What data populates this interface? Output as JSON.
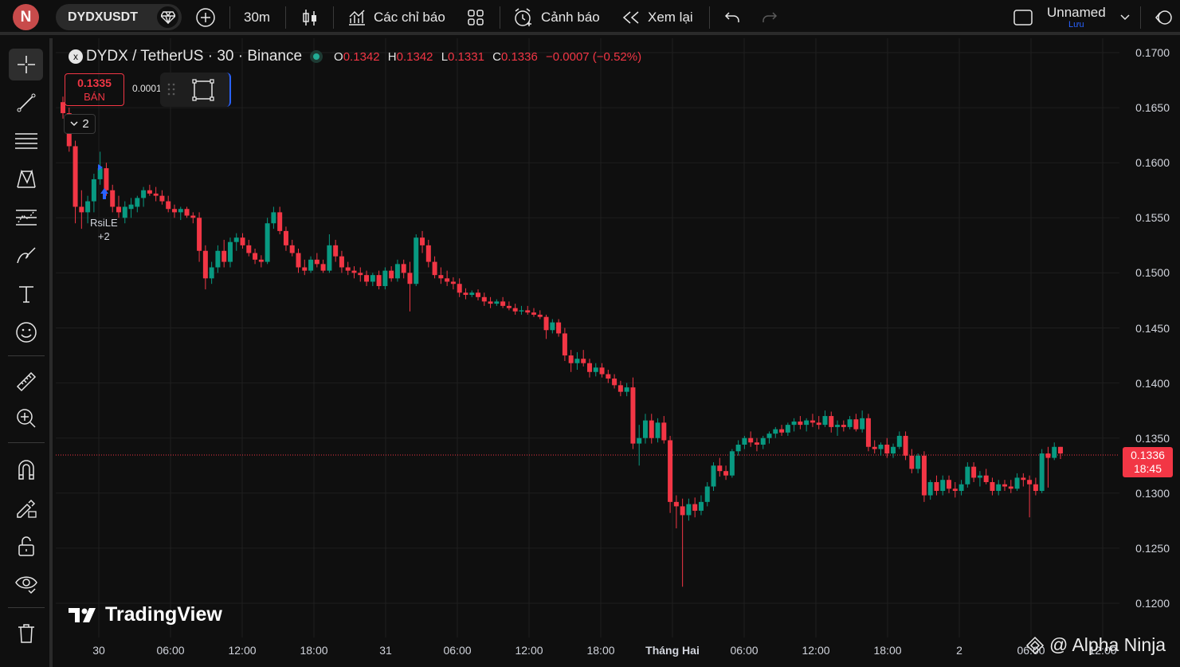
{
  "header": {
    "logo_letter": "N",
    "symbol": "DYDXUSDT",
    "interval": "30m",
    "indicators_label": "Các chỉ báo",
    "alerts_label": "Cảnh báo",
    "replay_label": "Xem lại",
    "layout_name": "Unnamed",
    "save_label": "Lưu"
  },
  "legend": {
    "title": "DYDX / TetherUS · 30 · Binance",
    "o_key": "O",
    "o_val": "0.1342",
    "h_key": "H",
    "h_val": "0.1342",
    "l_key": "L",
    "l_val": "0.1331",
    "c_key": "C",
    "c_val": "0.1336",
    "change": "−0.0007 (−0.52%)"
  },
  "trade": {
    "sell_price": "0.1335",
    "sell_label": "BÁN",
    "spread": "0.0001"
  },
  "indicators_collapse": "2",
  "signal": {
    "label": "RsiLE",
    "extra": "+2"
  },
  "price_axis": [
    "0.1700",
    "0.1650",
    "0.1600",
    "0.1550",
    "0.1500",
    "0.1450",
    "0.1400",
    "0.1350",
    "0.1300",
    "0.1250",
    "0.1200"
  ],
  "last_price": {
    "value": "0.1336",
    "countdown": "18:45"
  },
  "time_axis": [
    "30",
    "06:00",
    "12:00",
    "18:00",
    "31",
    "06:00",
    "12:00",
    "18:00",
    "Tháng Hai",
    "06:00",
    "12:00",
    "18:00",
    "2",
    "06:00",
    "12:00"
  ],
  "brand": "TradingView",
  "watermark": "@ Alpha Ninja",
  "colors": {
    "up": "#089981",
    "down": "#f23645",
    "background": "#0f0f0f",
    "grid": "#1f1f1f"
  },
  "chart_data": {
    "type": "candlestick",
    "ylim": [
      0.1195,
      0.1705
    ],
    "last_price": 0.1336,
    "candles": [
      [
        0.1655,
        0.166,
        0.164,
        0.1645
      ],
      [
        0.1645,
        0.165,
        0.161,
        0.1615
      ],
      [
        0.1615,
        0.162,
        0.1545,
        0.156
      ],
      [
        0.156,
        0.1575,
        0.154,
        0.1555
      ],
      [
        0.1555,
        0.157,
        0.1545,
        0.1565
      ],
      [
        0.1565,
        0.159,
        0.1555,
        0.1585
      ],
      [
        0.1585,
        0.161,
        0.158,
        0.1595
      ],
      [
        0.1595,
        0.16,
        0.157,
        0.1575
      ],
      [
        0.1575,
        0.158,
        0.1555,
        0.156
      ],
      [
        0.156,
        0.157,
        0.155,
        0.1555
      ],
      [
        0.155,
        0.1565,
        0.1545,
        0.156
      ],
      [
        0.1558,
        0.1568,
        0.155,
        0.1562
      ],
      [
        0.156,
        0.157,
        0.1555,
        0.1568
      ],
      [
        0.1568,
        0.1578,
        0.156,
        0.1575
      ],
      [
        0.1575,
        0.158,
        0.157,
        0.1572
      ],
      [
        0.1572,
        0.1578,
        0.1565,
        0.157
      ],
      [
        0.157,
        0.1575,
        0.1562,
        0.1565
      ],
      [
        0.1565,
        0.157,
        0.1555,
        0.1558
      ],
      [
        0.1558,
        0.1562,
        0.155,
        0.1555
      ],
      [
        0.1555,
        0.156,
        0.1548,
        0.1558
      ],
      [
        0.1558,
        0.156,
        0.155,
        0.1552
      ],
      [
        0.1552,
        0.1555,
        0.1545,
        0.155
      ],
      [
        0.155,
        0.1555,
        0.151,
        0.152
      ],
      [
        0.152,
        0.1525,
        0.1485,
        0.1495
      ],
      [
        0.1495,
        0.151,
        0.149,
        0.1505
      ],
      [
        0.1505,
        0.1525,
        0.15,
        0.152
      ],
      [
        0.152,
        0.153,
        0.1505,
        0.151
      ],
      [
        0.151,
        0.1532,
        0.1505,
        0.1528
      ],
      [
        0.1528,
        0.1536,
        0.152,
        0.1532
      ],
      [
        0.1532,
        0.1536,
        0.1522,
        0.1525
      ],
      [
        0.1525,
        0.153,
        0.1515,
        0.1518
      ],
      [
        0.1518,
        0.1522,
        0.1508,
        0.1512
      ],
      [
        0.1512,
        0.1516,
        0.1505,
        0.151
      ],
      [
        0.151,
        0.155,
        0.1508,
        0.1545
      ],
      [
        0.1545,
        0.156,
        0.154,
        0.1555
      ],
      [
        0.1555,
        0.156,
        0.1535,
        0.1538
      ],
      [
        0.1538,
        0.1542,
        0.152,
        0.1525
      ],
      [
        0.1525,
        0.153,
        0.1515,
        0.1518
      ],
      [
        0.1518,
        0.1522,
        0.15,
        0.1505
      ],
      [
        0.1505,
        0.1512,
        0.1498,
        0.1502
      ],
      [
        0.1502,
        0.1515,
        0.15,
        0.1512
      ],
      [
        0.1512,
        0.1518,
        0.1505,
        0.1508
      ],
      [
        0.1508,
        0.1512,
        0.15,
        0.1502
      ],
      [
        0.1502,
        0.1535,
        0.15,
        0.1525
      ],
      [
        0.1525,
        0.153,
        0.151,
        0.1515
      ],
      [
        0.1515,
        0.152,
        0.15,
        0.1505
      ],
      [
        0.1505,
        0.151,
        0.1498,
        0.1502
      ],
      [
        0.1502,
        0.1506,
        0.1495,
        0.15
      ],
      [
        0.15,
        0.1505,
        0.1492,
        0.1498
      ],
      [
        0.1498,
        0.1502,
        0.1488,
        0.1492
      ],
      [
        0.1492,
        0.15,
        0.1488,
        0.1498
      ],
      [
        0.1498,
        0.1502,
        0.1485,
        0.1488
      ],
      [
        0.1488,
        0.1505,
        0.1485,
        0.1502
      ],
      [
        0.1502,
        0.1506,
        0.1492,
        0.1495
      ],
      [
        0.1495,
        0.1512,
        0.1492,
        0.1508
      ],
      [
        0.1508,
        0.1512,
        0.1495,
        0.15
      ],
      [
        0.15,
        0.151,
        0.1465,
        0.149
      ],
      [
        0.149,
        0.1535,
        0.1488,
        0.1532
      ],
      [
        0.1532,
        0.1538,
        0.1518,
        0.1525
      ],
      [
        0.1525,
        0.153,
        0.1505,
        0.151
      ],
      [
        0.151,
        0.1515,
        0.1495,
        0.1498
      ],
      [
        0.1498,
        0.1505,
        0.149,
        0.1495
      ],
      [
        0.1495,
        0.1502,
        0.1488,
        0.1492
      ],
      [
        0.1492,
        0.1496,
        0.1485,
        0.149
      ],
      [
        0.149,
        0.1495,
        0.1478,
        0.1482
      ],
      [
        0.1482,
        0.1486,
        0.1476,
        0.148
      ],
      [
        0.148,
        0.1484,
        0.1478,
        0.1482
      ],
      [
        0.1482,
        0.1485,
        0.1475,
        0.1478
      ],
      [
        0.1478,
        0.1482,
        0.147,
        0.1474
      ],
      [
        0.1474,
        0.1478,
        0.1468,
        0.1472
      ],
      [
        0.1472,
        0.1476,
        0.147,
        0.1474
      ],
      [
        0.1474,
        0.1478,
        0.1468,
        0.147
      ],
      [
        0.147,
        0.1474,
        0.1466,
        0.1468
      ],
      [
        0.1468,
        0.1472,
        0.1462,
        0.1465
      ],
      [
        0.1465,
        0.147,
        0.1462,
        0.1466
      ],
      [
        0.1466,
        0.147,
        0.1462,
        0.1464
      ],
      [
        0.1464,
        0.1468,
        0.146,
        0.1462
      ],
      [
        0.1462,
        0.1466,
        0.1458,
        0.146
      ],
      [
        0.146,
        0.1462,
        0.144,
        0.1448
      ],
      [
        0.1448,
        0.1458,
        0.1445,
        0.1455
      ],
      [
        0.1455,
        0.1458,
        0.1442,
        0.1445
      ],
      [
        0.1445,
        0.145,
        0.142,
        0.1425
      ],
      [
        0.1425,
        0.143,
        0.141,
        0.1418
      ],
      [
        0.1418,
        0.1428,
        0.1412,
        0.1422
      ],
      [
        0.1422,
        0.143,
        0.1415,
        0.1418
      ],
      [
        0.1418,
        0.1422,
        0.1405,
        0.141
      ],
      [
        0.141,
        0.1418,
        0.1406,
        0.1414
      ],
      [
        0.1414,
        0.1418,
        0.1405,
        0.1408
      ],
      [
        0.1408,
        0.1412,
        0.14,
        0.1404
      ],
      [
        0.1404,
        0.1408,
        0.1395,
        0.1398
      ],
      [
        0.1398,
        0.1402,
        0.1388,
        0.1392
      ],
      [
        0.1392,
        0.14,
        0.1388,
        0.1396
      ],
      [
        0.1396,
        0.1405,
        0.134,
        0.1345
      ],
      [
        0.1345,
        0.1362,
        0.1325,
        0.135
      ],
      [
        0.135,
        0.1372,
        0.1345,
        0.1366
      ],
      [
        0.1366,
        0.1372,
        0.1345,
        0.135
      ],
      [
        0.135,
        0.1368,
        0.1346,
        0.1364
      ],
      [
        0.1364,
        0.137,
        0.1345,
        0.1348
      ],
      [
        0.1348,
        0.1352,
        0.1282,
        0.1292
      ],
      [
        0.1292,
        0.1298,
        0.1268,
        0.1288
      ],
      [
        0.1288,
        0.1295,
        0.1215,
        0.128
      ],
      [
        0.128,
        0.1295,
        0.1275,
        0.129
      ],
      [
        0.129,
        0.1296,
        0.1278,
        0.1284
      ],
      [
        0.1284,
        0.1298,
        0.128,
        0.1292
      ],
      [
        0.1292,
        0.131,
        0.1288,
        0.1306
      ],
      [
        0.1306,
        0.1328,
        0.1302,
        0.1325
      ],
      [
        0.1325,
        0.1332,
        0.1315,
        0.132
      ],
      [
        0.132,
        0.1325,
        0.1312,
        0.1316
      ],
      [
        0.1316,
        0.134,
        0.1314,
        0.1338
      ],
      [
        0.1338,
        0.1348,
        0.1334,
        0.1344
      ],
      [
        0.1344,
        0.1352,
        0.134,
        0.135
      ],
      [
        0.135,
        0.1356,
        0.1342,
        0.1346
      ],
      [
        0.1346,
        0.135,
        0.1338,
        0.1344
      ],
      [
        0.1344,
        0.1352,
        0.134,
        0.135
      ],
      [
        0.135,
        0.1356,
        0.1345,
        0.1354
      ],
      [
        0.1354,
        0.136,
        0.135,
        0.1358
      ],
      [
        0.1358,
        0.1362,
        0.1352,
        0.1355
      ],
      [
        0.1355,
        0.1364,
        0.1352,
        0.1362
      ],
      [
        0.1362,
        0.1368,
        0.1356,
        0.1365
      ],
      [
        0.1365,
        0.137,
        0.1358,
        0.1362
      ],
      [
        0.1362,
        0.1368,
        0.1356,
        0.1366
      ],
      [
        0.1366,
        0.1372,
        0.136,
        0.1364
      ],
      [
        0.1364,
        0.137,
        0.1358,
        0.1362
      ],
      [
        0.1362,
        0.1375,
        0.136,
        0.137
      ],
      [
        0.137,
        0.1374,
        0.1355,
        0.136
      ],
      [
        0.136,
        0.1366,
        0.1352,
        0.1362
      ],
      [
        0.1362,
        0.1366,
        0.1356,
        0.136
      ],
      [
        0.136,
        0.137,
        0.1358,
        0.1367
      ],
      [
        0.1367,
        0.1372,
        0.1356,
        0.1358
      ],
      [
        0.1358,
        0.1375,
        0.1355,
        0.1368
      ],
      [
        0.1368,
        0.1372,
        0.1338,
        0.1342
      ],
      [
        0.1342,
        0.1348,
        0.1336,
        0.134
      ],
      [
        0.134,
        0.1346,
        0.1334,
        0.1344
      ],
      [
        0.1344,
        0.135,
        0.1332,
        0.1336
      ],
      [
        0.1336,
        0.1345,
        0.1332,
        0.1342
      ],
      [
        0.1342,
        0.1356,
        0.134,
        0.1352
      ],
      [
        0.1352,
        0.1356,
        0.133,
        0.1334
      ],
      [
        0.1334,
        0.134,
        0.1318,
        0.1322
      ],
      [
        0.1322,
        0.1336,
        0.1318,
        0.1334
      ],
      [
        0.1334,
        0.1338,
        0.1292,
        0.1298
      ],
      [
        0.1298,
        0.1312,
        0.1294,
        0.131
      ],
      [
        0.131,
        0.1316,
        0.1298,
        0.1302
      ],
      [
        0.1302,
        0.1316,
        0.1298,
        0.1312
      ],
      [
        0.1312,
        0.1316,
        0.13,
        0.1304
      ],
      [
        0.1304,
        0.131,
        0.1296,
        0.1302
      ],
      [
        0.1302,
        0.1312,
        0.1298,
        0.1308
      ],
      [
        0.1308,
        0.1328,
        0.1305,
        0.1324
      ],
      [
        0.1324,
        0.1328,
        0.131,
        0.1314
      ],
      [
        0.1314,
        0.132,
        0.1306,
        0.1316
      ],
      [
        0.1316,
        0.1322,
        0.1308,
        0.131
      ],
      [
        0.131,
        0.1314,
        0.1298,
        0.1302
      ],
      [
        0.1302,
        0.1312,
        0.1298,
        0.1308
      ],
      [
        0.1308,
        0.1312,
        0.1302,
        0.1306
      ],
      [
        0.1306,
        0.1312,
        0.13,
        0.1304
      ],
      [
        0.1304,
        0.1318,
        0.1302,
        0.1314
      ],
      [
        0.1314,
        0.1318,
        0.1306,
        0.1312
      ],
      [
        0.1312,
        0.1316,
        0.1278,
        0.1308
      ],
      [
        0.1308,
        0.1314,
        0.1298,
        0.1302
      ],
      [
        0.1302,
        0.134,
        0.13,
        0.1336
      ],
      [
        0.1336,
        0.1342,
        0.1305,
        0.1332
      ],
      [
        0.1332,
        0.1346,
        0.133,
        0.1342
      ],
      [
        0.1342,
        0.1342,
        0.1331,
        0.1336
      ]
    ]
  }
}
